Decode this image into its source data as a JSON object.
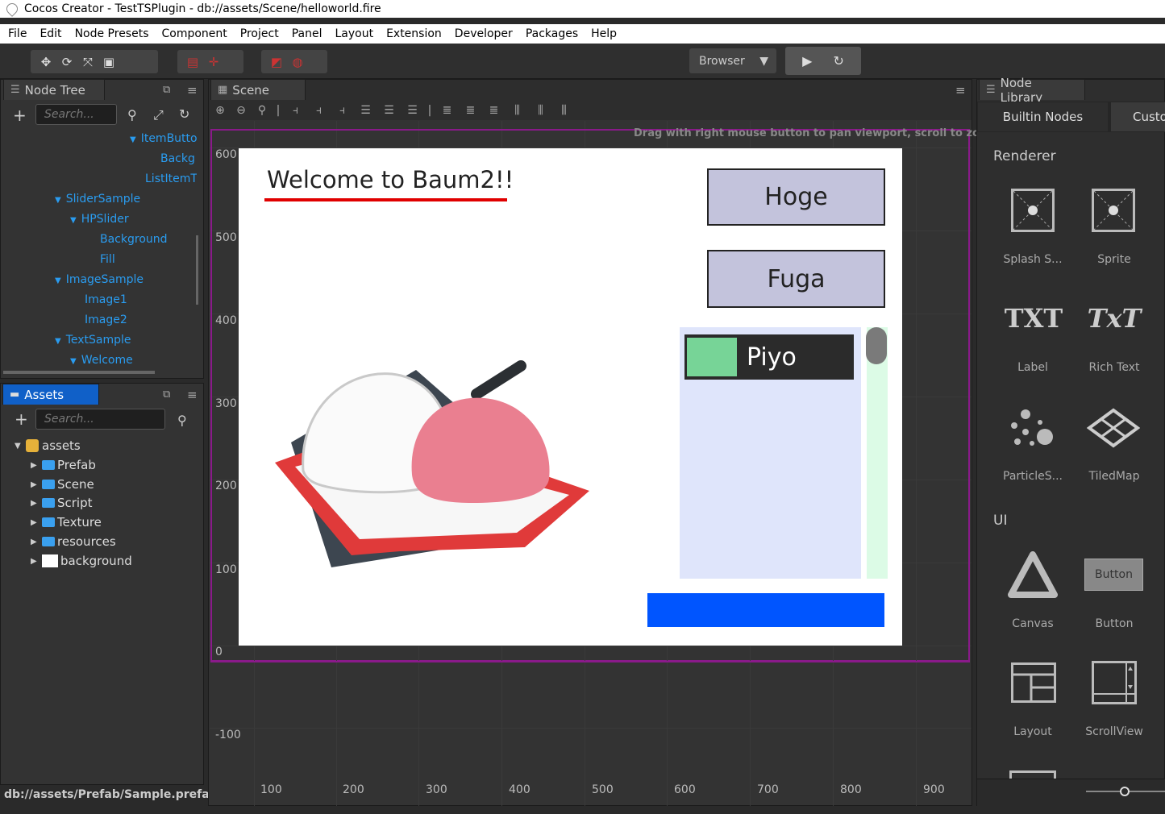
{
  "window": {
    "title": "Cocos Creator - TestTSPlugin - db://assets/Scene/helloworld.fire"
  },
  "menu": [
    "File",
    "Edit",
    "Node Presets",
    "Component",
    "Project",
    "Panel",
    "Layout",
    "Extension",
    "Developer",
    "Packages",
    "Help"
  ],
  "toolbar": {
    "browser_label": "Browser"
  },
  "node_tree": {
    "tab_label": "Node Tree",
    "search_placeholder": "Search...",
    "items": [
      {
        "label": "ItemButto",
        "indent": 3,
        "expanded": true
      },
      {
        "label": "Backg",
        "indent": 4
      },
      {
        "label": "ListItemT",
        "indent": 4
      },
      {
        "label": "SliderSample",
        "indent": 1,
        "expanded": true
      },
      {
        "label": "HPSlider",
        "indent": 2,
        "expanded": true
      },
      {
        "label": "Background",
        "indent": 3
      },
      {
        "label": "Fill",
        "indent": 3
      },
      {
        "label": "ImageSample",
        "indent": 1,
        "expanded": true
      },
      {
        "label": "Image1",
        "indent": 2
      },
      {
        "label": "Image2",
        "indent": 2
      },
      {
        "label": "TextSample",
        "indent": 1,
        "expanded": true
      },
      {
        "label": "Welcome",
        "indent": 2,
        "expanded": true
      }
    ]
  },
  "assets": {
    "tab_label": "Assets",
    "search_placeholder": "Search...",
    "root": "assets",
    "items": [
      "Prefab",
      "Scene",
      "Script",
      "Texture",
      "resources",
      "background"
    ],
    "status_path": "db://assets/Prefab/Sample.prefab"
  },
  "scene": {
    "tab_label": "Scene",
    "hint": "Drag with right mouse button to pan viewport, scroll to zoom.",
    "y_labels": [
      "600",
      "500",
      "400",
      "300",
      "200",
      "100",
      "0",
      "-100"
    ],
    "x_labels": [
      "100",
      "200",
      "300",
      "400",
      "500",
      "600",
      "700",
      "800",
      "900"
    ],
    "welcome_text": "Welcome to Baum2!!",
    "button1": "Hoge",
    "button2": "Fuga",
    "list_item": "Piyo",
    "colors": {
      "accent_blue": "#0055ff",
      "underline": "#e00000",
      "button_bg": "#c3c3dc",
      "list_bg": "#dfe5fb",
      "item_green": "#77d497"
    }
  },
  "node_library": {
    "tab_label": "Node Library",
    "tabs": [
      "Builtin Nodes",
      "Custo"
    ],
    "sections": [
      "Renderer",
      "UI"
    ],
    "items": [
      "Splash S...",
      "Sprite",
      "Label",
      "Rich Text",
      "ParticleS...",
      "TiledMap",
      "Canvas",
      "Button",
      "Layout",
      "ScrollView"
    ],
    "button_icon_text": "Button",
    "txt1": "TXT",
    "txt2": "TxT"
  }
}
